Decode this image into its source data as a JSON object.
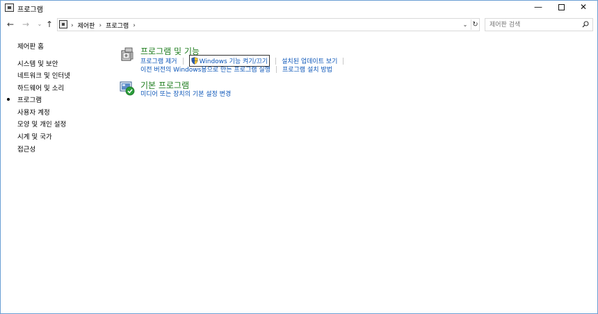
{
  "window": {
    "title": "프로그램",
    "minimize_glyph": "—",
    "close_glyph": "✕"
  },
  "nav": {
    "back_glyph": "←",
    "forward_glyph": "→",
    "recent_glyph": "⌄",
    "up_glyph": "↑"
  },
  "address": {
    "crumbs": [
      "제어판",
      "프로그램"
    ],
    "separator": "›",
    "dropdown_glyph": "⌄",
    "refresh_glyph": "↻"
  },
  "search": {
    "placeholder": "제어판 검색"
  },
  "sidebar": {
    "home": "제어판 홈",
    "items": [
      {
        "label": "시스템 및 보안",
        "active": false
      },
      {
        "label": "네트워크 및 인터넷",
        "active": false
      },
      {
        "label": "하드웨어 및 소리",
        "active": false
      },
      {
        "label": "프로그램",
        "active": true
      },
      {
        "label": "사용자 계정",
        "active": false
      },
      {
        "label": "모양 및 개인 설정",
        "active": false
      },
      {
        "label": "시계 및 국가",
        "active": false
      },
      {
        "label": "접근성",
        "active": false
      }
    ]
  },
  "categories": {
    "programs": {
      "title": "프로그램 및 기능",
      "row1": [
        "프로그램 제거",
        "Windows 기능 켜기/끄기",
        "설치된 업데이트 보기"
      ],
      "row2": [
        "이전 버전의 Windows용으로 만든 프로그램 실행",
        "프로그램 설치 방법"
      ]
    },
    "defaults": {
      "title": "기본 프로그램",
      "row1": [
        "미디어 또는 장치의 기본 설정 변경"
      ]
    }
  },
  "colors": {
    "link": "#0b55b8",
    "category_title": "#1e7d1e",
    "window_border": "#6a9fd4",
    "check_green": "#2a9d3a"
  }
}
